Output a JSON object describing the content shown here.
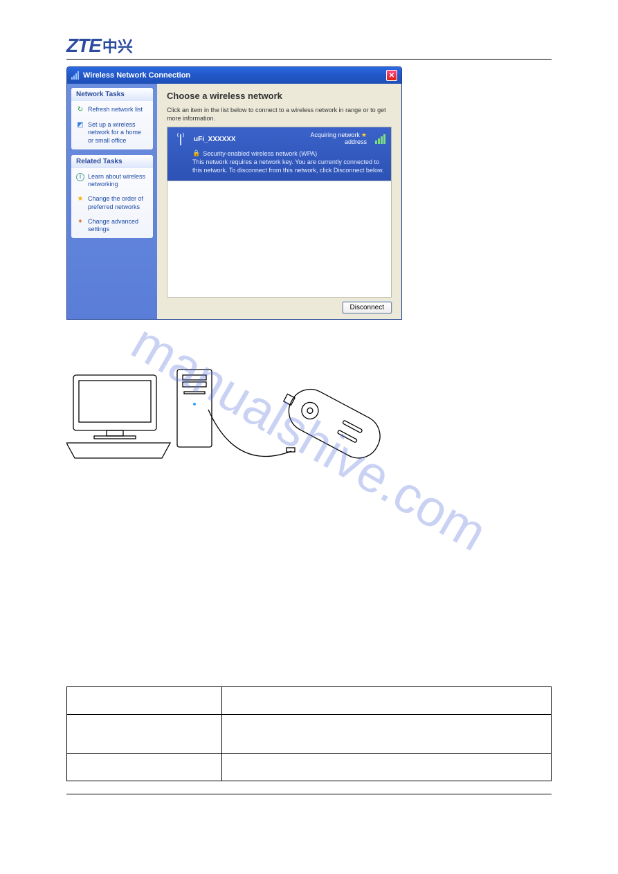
{
  "logo": {
    "en": "ZTE",
    "cn": "中兴"
  },
  "watermark": "manualshive.com",
  "window": {
    "title": "Wireless Network Connection",
    "main_title": "Choose a wireless network",
    "subtitle": "Click an item in the list below to connect to a wireless network in range or to get more information.",
    "disconnect_label": "Disconnect"
  },
  "sidebar": {
    "panel1": {
      "title": "Network Tasks",
      "refresh": "Refresh network list",
      "setup": "Set up a wireless network for a home or small office"
    },
    "panel2": {
      "title": "Related Tasks",
      "learn": "Learn about wireless networking",
      "order": "Change the order of preferred networks",
      "advanced": "Change advanced settings"
    }
  },
  "network": {
    "ssid": "uFi_XXXXXX",
    "status_line1": "Acquiring network",
    "status_line2": "address",
    "security": "Security-enabled wireless network (WPA)",
    "description": "This network requires a network key. You are currently connected to this network. To disconnect from this network, click Disconnect below."
  }
}
